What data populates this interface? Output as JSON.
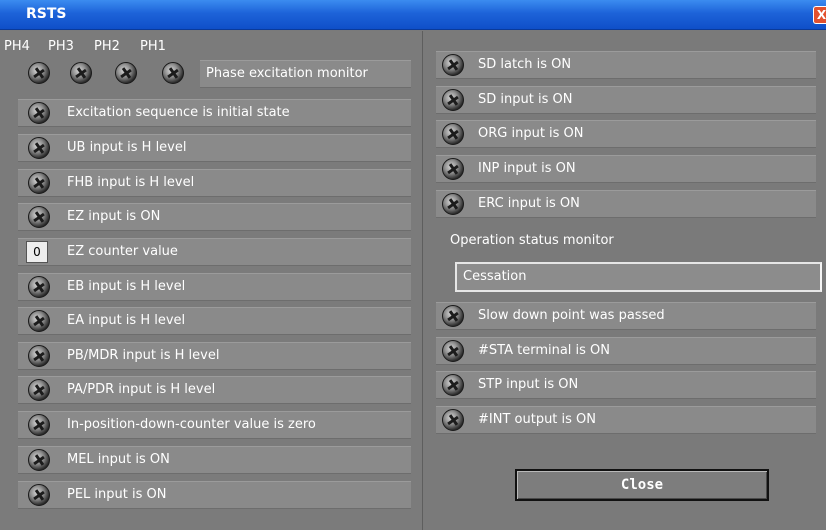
{
  "window": {
    "title": "RSTS",
    "close_glyph": "X"
  },
  "phase": {
    "labels": [
      "PH4",
      "PH3",
      "PH2",
      "PH1"
    ],
    "monitor_label": "Phase excitation monitor"
  },
  "left_items": [
    "Excitation sequence is initial state",
    "UB input is H level",
    "FHB input is H level",
    "EZ input is ON",
    "EZ counter value",
    "EB input is H level",
    "EA input is H level",
    "PB/MDR input is H level",
    "PA/PDR input is H level",
    "In-position-down-counter value is zero",
    "MEL input is ON",
    "PEL input is ON"
  ],
  "ez_counter": "0",
  "right_items_top": [
    "SD latch is ON",
    "SD input is ON",
    "ORG input is ON",
    "INP input is ON",
    "ERC input is ON"
  ],
  "operation_status": {
    "label": "Operation status monitor",
    "value": "Cessation"
  },
  "right_items_bottom": [
    "Slow down point was passed",
    "#STA terminal is ON",
    "STP input is ON",
    "#INT output is ON"
  ],
  "close_label": "Close",
  "colors": {
    "titlebar": "#1d63d9",
    "background": "#7b7b7b",
    "row": "#8a8a8a",
    "close_x": "#e2512e"
  }
}
